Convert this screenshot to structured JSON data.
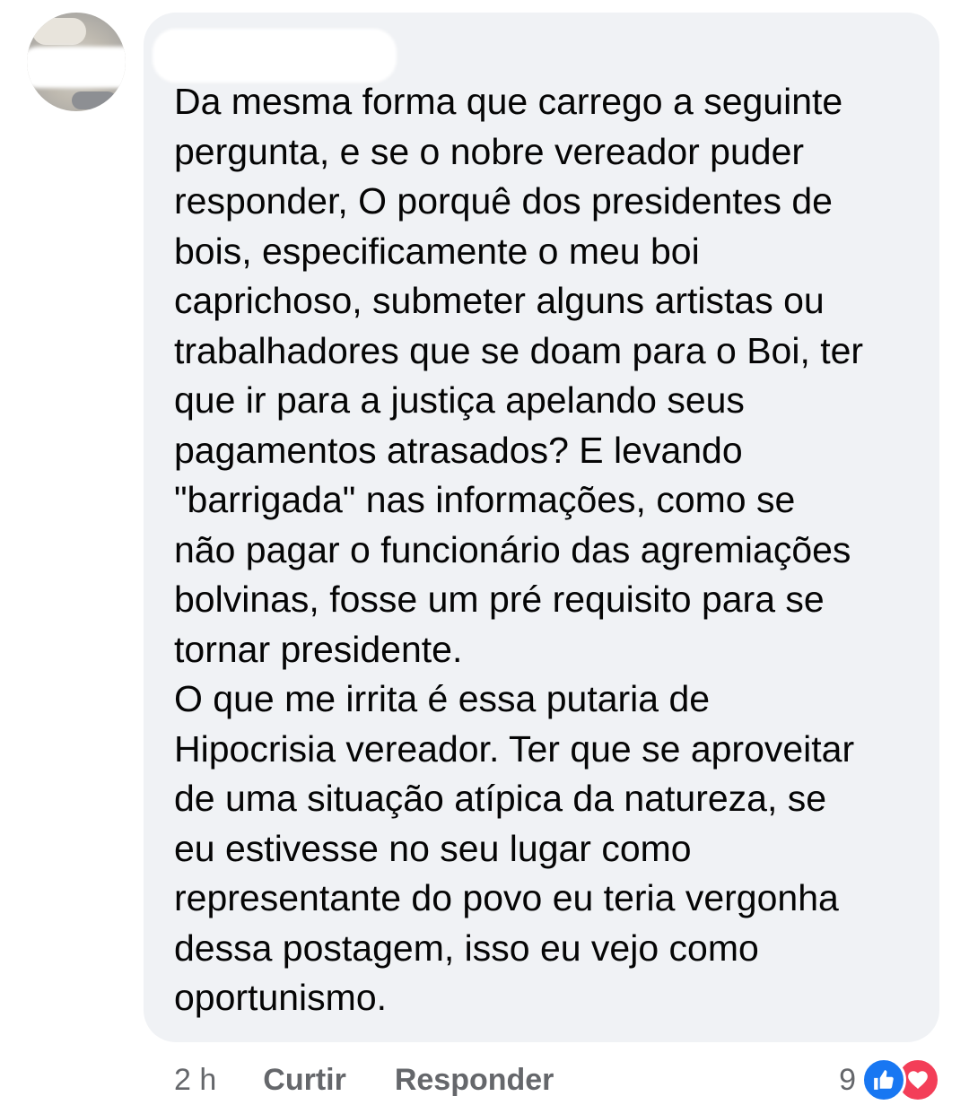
{
  "comment": {
    "text": "Da mesma forma que carrego a seguinte\npergunta, e se o nobre vereador puder\nresponder, O porquê dos presidentes de\nbois, especificamente o meu boi\ncaprichoso, submeter alguns artistas ou\ntrabalhadores que se doam para o Boi, ter\nque ir para a justiça apelando seus\npagamentos atrasados? E levando\n\"barrigada\" nas informações, como se\nnão pagar o funcionário das agremiações\nbolvinas, fosse um pré requisito para se\ntornar presidente.\nO que me irrita é essa putaria de\nHipocrisia vereador. Ter que se aproveitar\nde uma situação atípica da natureza, se\neu estivesse no seu lugar como\nrepresentante do povo eu teria vergonha\ndessa postagem, isso eu vejo como\noportunismo."
  },
  "actions": {
    "time": "2 h",
    "like_label": "Curtir",
    "reply_label": "Responder"
  },
  "reactions": {
    "count": "9",
    "icons": [
      "like-reaction-icon",
      "love-reaction-icon"
    ]
  },
  "colors": {
    "bubble": "#f0f2f5",
    "text": "#050505",
    "meta": "#65676b",
    "like": "#1877f2",
    "love": "#f33e58"
  }
}
